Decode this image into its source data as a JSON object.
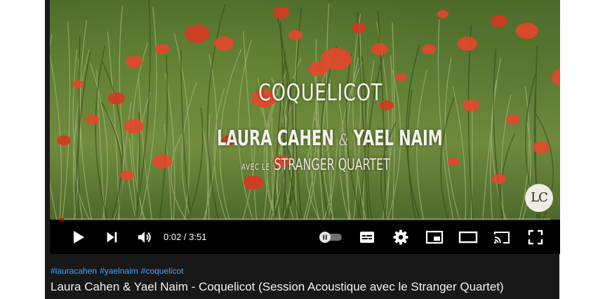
{
  "video": {
    "overlay_title": "COQUELICOT",
    "overlay_artist_1": "LAURA CAHEN",
    "overlay_ampersand": "&",
    "overlay_artist_2": "YAEL NAIM",
    "overlay_avec": "AVEC LE",
    "overlay_quartet": "STRANGER QUARTET",
    "logo_text": "LC"
  },
  "player": {
    "current_time": "0:02",
    "duration": "3:51",
    "time_display": "0:02 / 3:51",
    "progress_fraction": 0.009,
    "accent_color": "#ff0000"
  },
  "controls": {
    "play_icon": "play-icon",
    "next_icon": "next-icon",
    "volume_icon": "volume-icon",
    "autoplay_icon": "autoplay-toggle-icon",
    "subtitles_icon": "subtitles-icon",
    "settings_icon": "gear-icon",
    "miniplayer_icon": "miniplayer-icon",
    "theater_icon": "theater-mode-icon",
    "cast_icon": "cast-icon",
    "fullscreen_icon": "fullscreen-icon"
  },
  "info": {
    "hashtags": [
      "#lauracahen",
      "#yaelnaim",
      "#coquelicot"
    ],
    "title": "Laura Cahen & Yael Naim - Coquelicot (Session Acoustique avec le Stranger Quartet)",
    "hashtag_color": "#3ea6ff"
  }
}
